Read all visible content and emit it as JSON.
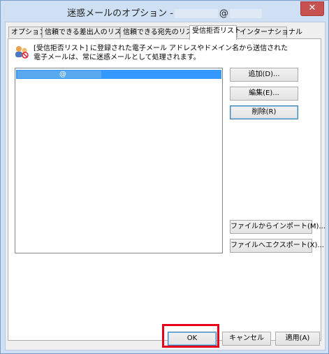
{
  "window": {
    "title_prefix": "迷惑メールのオプション -",
    "title_at": "@",
    "close_glyph": "✕"
  },
  "tabs": [
    {
      "label": "オプション"
    },
    {
      "label": "信頼できる差出人のリスト"
    },
    {
      "label": "信頼できる宛先のリスト"
    },
    {
      "label": "受信拒否リスト"
    },
    {
      "label": "インターナショナル"
    }
  ],
  "active_tab": "受信拒否リスト",
  "description": {
    "line1": "[受信拒否リスト] に登録された電子メール アドレスやドメイン名から送信された",
    "line2": "電子メールは、常に迷惑メールとして処理されます。"
  },
  "blocked_list": {
    "items": [
      {
        "text": "@"
      }
    ]
  },
  "buttons": {
    "add": "追加(D)...",
    "edit": "編集(E)...",
    "delete": "削除(R)",
    "import": "ファイルからインポート(M)...",
    "export": "ファイルへエクスポート(X)..."
  },
  "footer": {
    "ok": "OK",
    "cancel": "キャンセル",
    "apply": "適用(A)"
  },
  "colors": {
    "selection": "#3399ff",
    "highlight_box": "#e6001a",
    "close_button": "#c75050"
  }
}
